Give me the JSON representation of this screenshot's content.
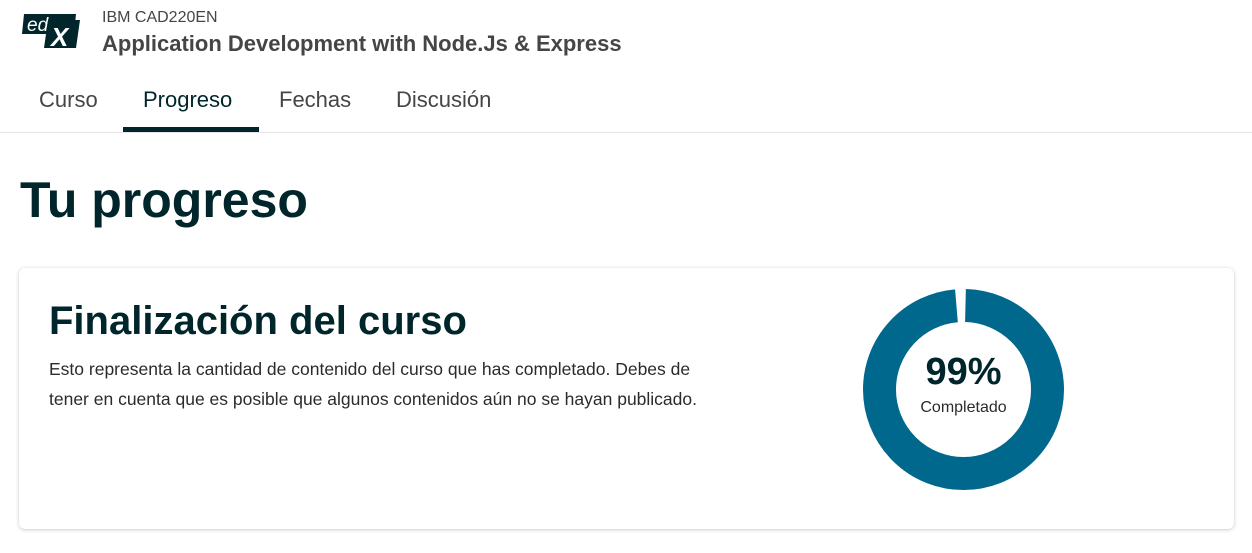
{
  "logo": {
    "text_ed": "ed",
    "text_x": "X"
  },
  "course": {
    "org_number": "IBM CAD220EN",
    "title": "Application Development with Node.Js & Express"
  },
  "tabs": [
    {
      "label": "Curso",
      "active": false
    },
    {
      "label": "Progreso",
      "active": true
    },
    {
      "label": "Fechas",
      "active": false
    },
    {
      "label": "Discusión",
      "active": false
    }
  ],
  "page": {
    "title": "Tu progreso"
  },
  "completion": {
    "title": "Finalización del curso",
    "description": "Esto representa la cantidad de contenido del curso que has completado. Debes de tener en cuenta que es posible que algunos contenidos aún no se hayan publicado.",
    "percent_label": "99%",
    "percent_value": 99,
    "status_label": "Completado"
  },
  "colors": {
    "primary_dark": "#00262b",
    "progress_fill": "#00688d",
    "progress_gap": "#ffffff"
  }
}
